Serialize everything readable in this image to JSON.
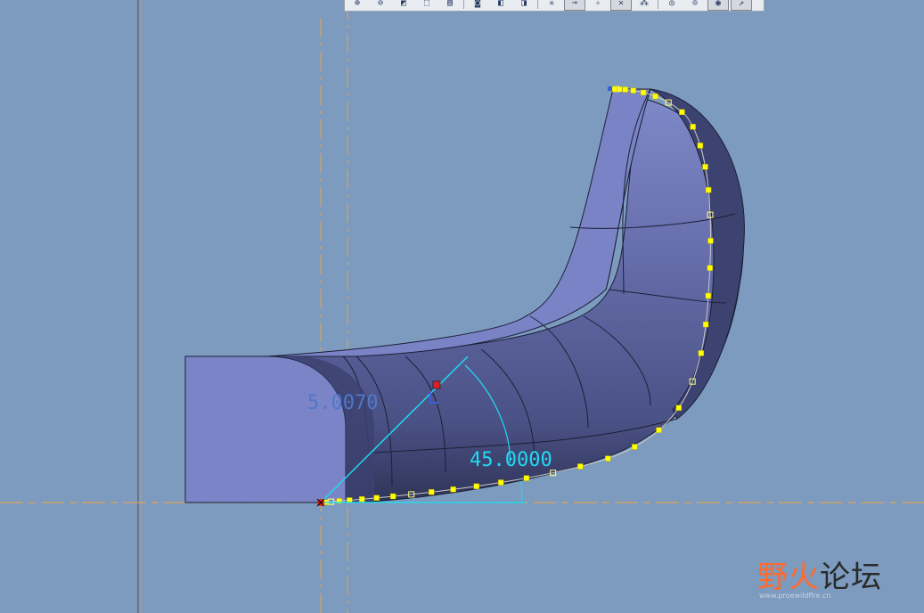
{
  "toolbar": {
    "buttons": [
      {
        "name": "zoom-in-icon",
        "glyph": "⊕",
        "pressed": false
      },
      {
        "name": "zoom-out-icon",
        "glyph": "⊖",
        "pressed": false
      },
      {
        "name": "refit-icon",
        "glyph": "◩",
        "pressed": false
      },
      {
        "name": "orient-icon",
        "glyph": "⬚",
        "pressed": false
      },
      {
        "name": "saved-views-icon",
        "glyph": "▤",
        "pressed": false
      },
      {
        "name": "camera-icon",
        "glyph": "◙",
        "pressed": false
      },
      {
        "name": "display-style-icon",
        "glyph": "◧",
        "pressed": false
      },
      {
        "name": "view-manager-icon",
        "glyph": "◨",
        "pressed": false
      },
      {
        "name": "datum-planes-icon",
        "glyph": "✳",
        "pressed": false
      },
      {
        "name": "datum-axes-icon",
        "glyph": "⊸",
        "pressed": true
      },
      {
        "name": "datum-points-icon",
        "glyph": "✧",
        "pressed": false
      },
      {
        "name": "csys-display-icon",
        "glyph": "✕",
        "pressed": true
      },
      {
        "name": "annotation-display-icon",
        "glyph": "⁂",
        "pressed": false
      },
      {
        "name": "spin-center-icon",
        "glyph": "◎",
        "pressed": false
      },
      {
        "name": "hidden-line-icon",
        "glyph": "⊙",
        "pressed": false
      },
      {
        "name": "no-hidden-icon",
        "glyph": "◉",
        "pressed": true
      },
      {
        "name": "curve-display-icon",
        "glyph": "↗",
        "pressed": true
      }
    ]
  },
  "dimensions": {
    "radius": "5.0070",
    "angle": "45.0000"
  },
  "watermark": {
    "part1": "野火",
    "part2": "论坛",
    "url": "www.proewildfire.cn"
  },
  "colors": {
    "background": "#7c9bbf",
    "solid_face": "#7d86c6",
    "solid_dark": "#3b4168",
    "dimension": "#22d8f0",
    "sketch_points": "#ffff00",
    "datum_axis": "#e0a35a"
  }
}
